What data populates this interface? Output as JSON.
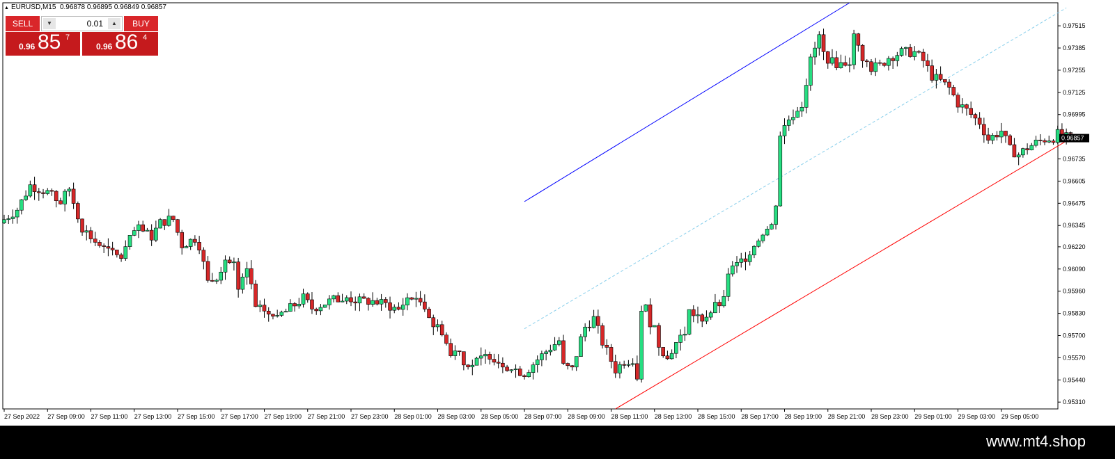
{
  "header": {
    "symbol": "EURUSD,M15",
    "open": "0.96878",
    "high": "0.96895",
    "low": "0.96849",
    "close": "0.96857"
  },
  "trade_panel": {
    "sell_label": "SELL",
    "buy_label": "BUY",
    "lot_value": "0.01",
    "sell_price": {
      "prefix": "0.96",
      "big": "85",
      "sup": "7"
    },
    "buy_price": {
      "prefix": "0.96",
      "big": "86",
      "sup": "4"
    }
  },
  "footer": {
    "watermark": "www.mt4.shop"
  },
  "colors": {
    "bull": "#26de81",
    "bear": "#d62728",
    "wick": "#000000",
    "channel_upper": "#0000ff",
    "channel_mid": "#87ceeb",
    "channel_lower": "#ff0000"
  },
  "chart_data": {
    "type": "candlestick",
    "ylim": [
      0.9527,
      0.9765
    ],
    "y_ticks": [
      "0.97515",
      "0.97385",
      "0.97255",
      "0.97125",
      "0.96995",
      "0.96735",
      "0.96605",
      "0.96475",
      "0.96345",
      "0.96220",
      "0.96090",
      "0.95960",
      "0.95830",
      "0.95700",
      "0.95570",
      "0.95440",
      "0.95310"
    ],
    "current_price": "0.96857",
    "x_labels": [
      "27 Sep 2022",
      "27 Sep 09:00",
      "27 Sep 11:00",
      "27 Sep 13:00",
      "27 Sep 15:00",
      "27 Sep 17:00",
      "27 Sep 19:00",
      "27 Sep 21:00",
      "27 Sep 23:00",
      "28 Sep 01:00",
      "28 Sep 03:00",
      "28 Sep 05:00",
      "28 Sep 07:00",
      "28 Sep 09:00",
      "28 Sep 11:00",
      "28 Sep 13:00",
      "28 Sep 15:00",
      "28 Sep 17:00",
      "28 Sep 19:00",
      "28 Sep 21:00",
      "28 Sep 23:00",
      "29 Sep 01:00",
      "29 Sep 03:00",
      "29 Sep 05:00"
    ],
    "close_path": [
      [
        0,
        0.9638
      ],
      [
        3,
        0.9644
      ],
      [
        6,
        0.9658
      ],
      [
        10,
        0.9654
      ],
      [
        13,
        0.9648
      ],
      [
        15,
        0.9656
      ],
      [
        16,
        0.9648
      ],
      [
        18,
        0.9633
      ],
      [
        21,
        0.9625
      ],
      [
        24,
        0.9619
      ],
      [
        27,
        0.9616
      ],
      [
        30,
        0.9631
      ],
      [
        31,
        0.9632
      ],
      [
        34,
        0.9628
      ],
      [
        36,
        0.9636
      ],
      [
        38,
        0.9638
      ],
      [
        39,
        0.9638
      ],
      [
        41,
        0.9623
      ],
      [
        44,
        0.9627
      ],
      [
        45,
        0.9623
      ],
      [
        47,
        0.9601
      ],
      [
        49,
        0.9605
      ],
      [
        51,
        0.9615
      ],
      [
        53,
        0.961
      ],
      [
        54,
        0.9596
      ],
      [
        56,
        0.9608
      ],
      [
        57,
        0.96
      ],
      [
        58,
        0.9585
      ],
      [
        60,
        0.9585
      ],
      [
        62,
        0.958
      ],
      [
        65,
        0.9584
      ],
      [
        69,
        0.9592
      ],
      [
        71,
        0.9586
      ],
      [
        76,
        0.9591
      ],
      [
        79,
        0.9592
      ],
      [
        82,
        0.959
      ],
      [
        85,
        0.959
      ],
      [
        88,
        0.9588
      ],
      [
        91,
        0.9585
      ],
      [
        93,
        0.9592
      ],
      [
        95,
        0.9592
      ],
      [
        97,
        0.9588
      ],
      [
        99,
        0.9576
      ],
      [
        101,
        0.9573
      ],
      [
        103,
        0.9558
      ],
      [
        105,
        0.9563
      ],
      [
        106,
        0.9553
      ],
      [
        107,
        0.9554
      ],
      [
        108,
        0.9553
      ],
      [
        112,
        0.9559
      ],
      [
        114,
        0.9555
      ],
      [
        117,
        0.9551
      ],
      [
        120,
        0.9548
      ],
      [
        123,
        0.9556
      ],
      [
        126,
        0.9563
      ],
      [
        128,
        0.9567
      ],
      [
        129,
        0.9552
      ],
      [
        131,
        0.955
      ],
      [
        133,
        0.9568
      ],
      [
        134,
        0.9575
      ],
      [
        136,
        0.958
      ],
      [
        138,
        0.9566
      ],
      [
        141,
        0.955
      ],
      [
        143,
        0.9555
      ],
      [
        145,
        0.9556
      ],
      [
        146,
        0.9546
      ],
      [
        147,
        0.9583
      ],
      [
        148,
        0.9586
      ],
      [
        149,
        0.9578
      ],
      [
        150,
        0.9575
      ],
      [
        151,
        0.9565
      ],
      [
        152,
        0.9561
      ],
      [
        153,
        0.9556
      ],
      [
        155,
        0.9566
      ],
      [
        157,
        0.9572
      ],
      [
        158,
        0.9584
      ],
      [
        161,
        0.958
      ],
      [
        163,
        0.9584
      ],
      [
        164,
        0.9587
      ],
      [
        166,
        0.959
      ],
      [
        167,
        0.9607
      ],
      [
        169,
        0.9611
      ],
      [
        171,
        0.9616
      ],
      [
        173,
        0.9623
      ],
      [
        175,
        0.9631
      ],
      [
        177,
        0.9634
      ],
      [
        178,
        0.9648
      ],
      [
        179,
        0.9688
      ],
      [
        181,
        0.9697
      ],
      [
        184,
        0.9706
      ],
      [
        186,
        0.9731
      ],
      [
        188,
        0.9745
      ],
      [
        189,
        0.9735
      ],
      [
        191,
        0.973
      ],
      [
        193,
        0.9729
      ],
      [
        195,
        0.9731
      ],
      [
        196,
        0.9745
      ],
      [
        198,
        0.9733
      ],
      [
        200,
        0.9727
      ],
      [
        202,
        0.9728
      ],
      [
        204,
        0.9733
      ],
      [
        207,
        0.9736
      ],
      [
        210,
        0.9736
      ],
      [
        212,
        0.9731
      ],
      [
        214,
        0.9722
      ],
      [
        216,
        0.9719
      ],
      [
        218,
        0.9715
      ],
      [
        220,
        0.9706
      ],
      [
        222,
        0.9702
      ],
      [
        224,
        0.9697
      ],
      [
        225,
        0.9695
      ],
      [
        227,
        0.9685
      ],
      [
        230,
        0.969
      ],
      [
        232,
        0.9679
      ],
      [
        234,
        0.9676
      ],
      [
        236,
        0.968
      ],
      [
        238,
        0.9683
      ],
      [
        240,
        0.9685
      ],
      [
        242,
        0.9686
      ],
      [
        243,
        0.9688
      ],
      [
        245,
        0.9686
      ]
    ],
    "channel": {
      "upper": {
        "from": [
          120,
          0.96485
        ],
        "to": [
          195,
          0.9765
        ]
      },
      "mid": {
        "from": [
          120,
          0.9574
        ],
        "to": [
          245,
          0.9762
        ]
      },
      "lower": {
        "from": [
          141,
          0.9527
        ],
        "to": [
          245,
          0.9684
        ]
      }
    }
  }
}
